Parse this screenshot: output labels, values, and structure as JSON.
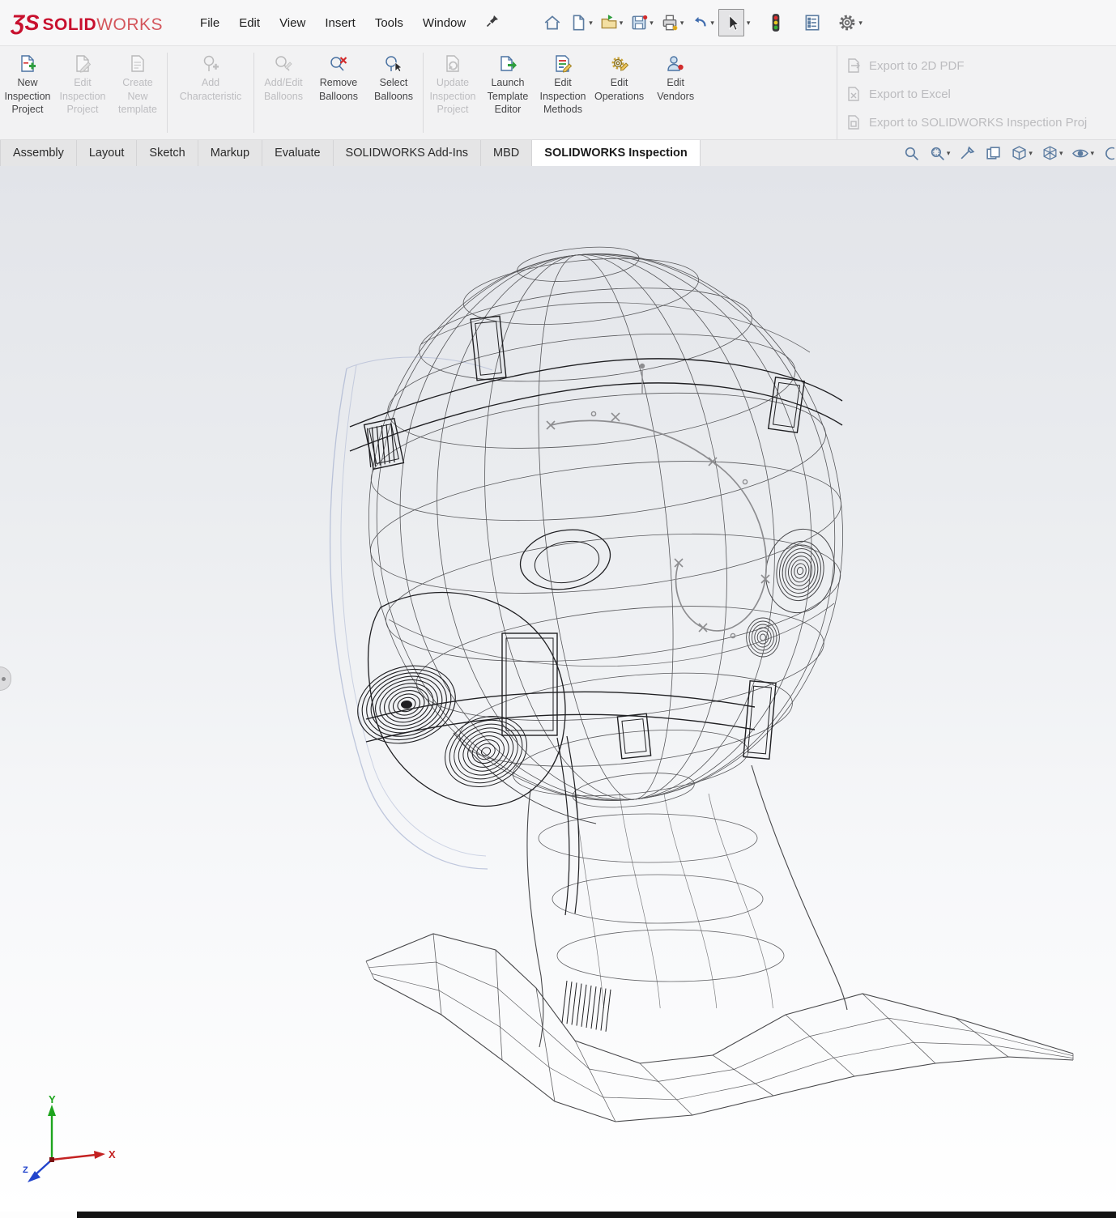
{
  "brand": {
    "mark": "ƷS",
    "solid": "SOLID",
    "works": "WORKS",
    "red": "#c8102e"
  },
  "menubar": {
    "items": [
      "File",
      "Edit",
      "View",
      "Insert",
      "Tools",
      "Window"
    ]
  },
  "quickbar": {
    "icons": [
      "home",
      "new-document",
      "open",
      "save",
      "print",
      "undo",
      "select",
      "traffic-light",
      "document-properties",
      "options"
    ]
  },
  "ribbon": {
    "buttons": [
      {
        "id": "new-inspection-project",
        "lines": [
          "New",
          "Inspection",
          "Project"
        ],
        "enabled": true
      },
      {
        "id": "edit-inspection-project",
        "lines": [
          "Edit",
          "Inspection",
          "Project"
        ],
        "enabled": false
      },
      {
        "id": "create-new-template",
        "lines": [
          "Create",
          "New",
          "template"
        ],
        "enabled": false
      },
      {
        "id": "add-characteristic",
        "lines": [
          "Add",
          "Characteristic"
        ],
        "enabled": false
      },
      {
        "id": "add-edit-balloons",
        "lines": [
          "Add/Edit",
          "Balloons"
        ],
        "enabled": false
      },
      {
        "id": "remove-balloons",
        "lines": [
          "Remove",
          "Balloons"
        ],
        "enabled": true
      },
      {
        "id": "select-balloons",
        "lines": [
          "Select",
          "Balloons"
        ],
        "enabled": true
      },
      {
        "id": "update-inspection-project",
        "lines": [
          "Update",
          "Inspection",
          "Project"
        ],
        "enabled": false
      },
      {
        "id": "launch-template-editor",
        "lines": [
          "Launch",
          "Template",
          "Editor"
        ],
        "enabled": true
      },
      {
        "id": "edit-inspection-methods",
        "lines": [
          "Edit",
          "Inspection",
          "Methods"
        ],
        "enabled": true
      },
      {
        "id": "edit-operations",
        "lines": [
          "Edit",
          "Operations"
        ],
        "enabled": true
      },
      {
        "id": "edit-vendors",
        "lines": [
          "Edit",
          "Vendors"
        ],
        "enabled": true
      }
    ],
    "exports": [
      {
        "label": "Export to 2D PDF",
        "enabled": false
      },
      {
        "label": "Export to Excel",
        "enabled": false
      },
      {
        "label": "Export to SOLIDWORKS Inspection Proj",
        "enabled": false
      }
    ]
  },
  "tabs": {
    "items": [
      "Assembly",
      "Layout",
      "Sketch",
      "Markup",
      "Evaluate",
      "SOLIDWORKS Add-Ins",
      "MBD",
      "SOLIDWORKS Inspection"
    ],
    "active": "SOLIDWORKS Inspection"
  },
  "viewport": {
    "triad": {
      "x": "X",
      "y": "Y",
      "z": "Z",
      "x_color": "#c42222",
      "y_color": "#1ea51e",
      "z_color": "#2244cc"
    },
    "wireframe": {
      "wire": "#47474a",
      "dense": "#1f1f22",
      "spline": "#8d8d90",
      "shield": "#9aa6c9"
    }
  }
}
